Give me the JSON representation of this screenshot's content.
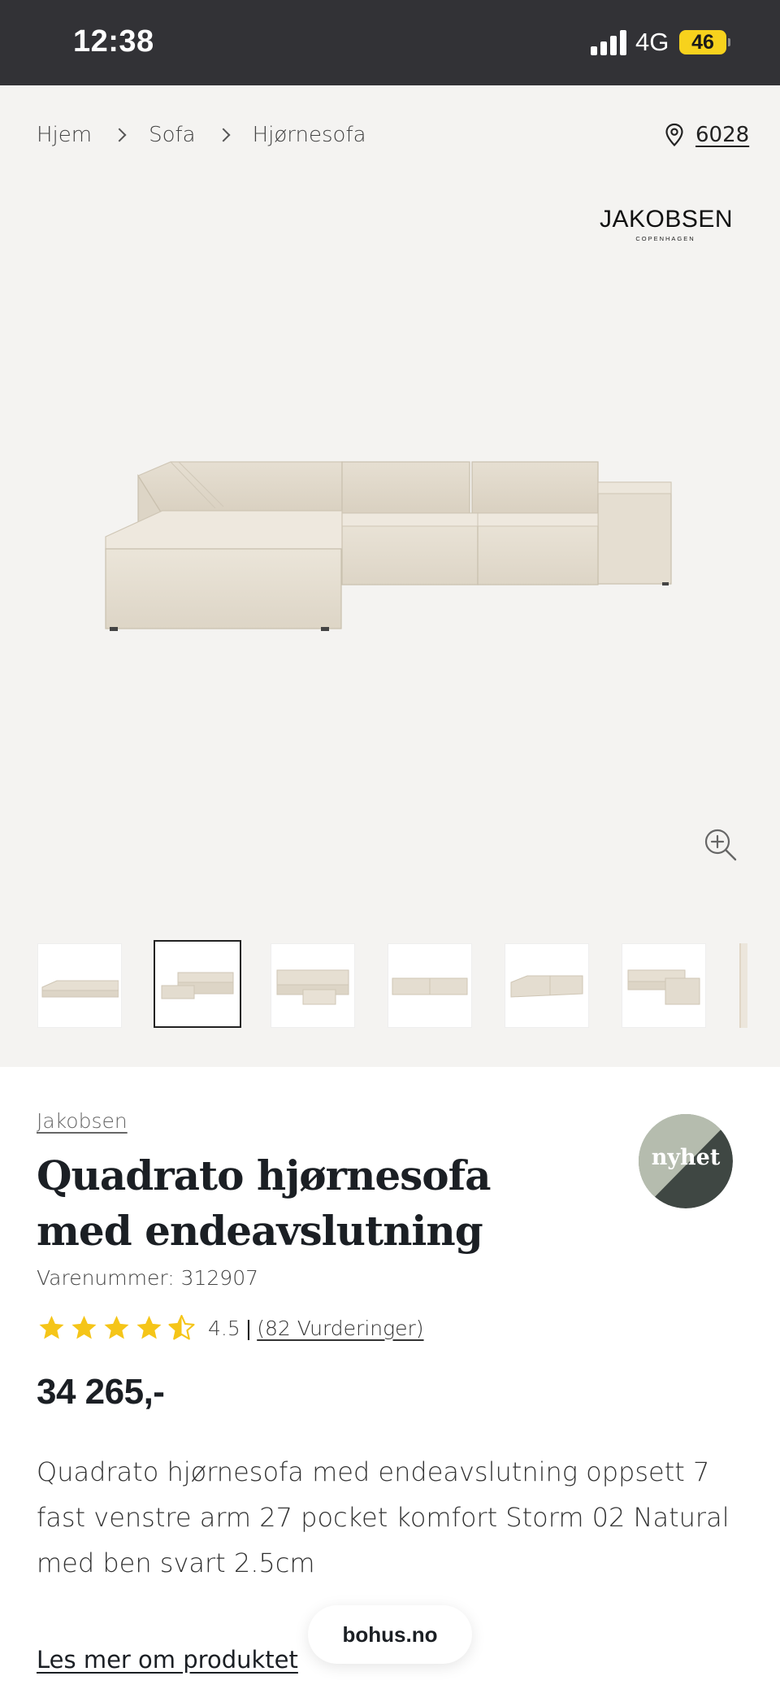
{
  "status_bar": {
    "time": "12:38",
    "network": "4G",
    "battery": "46"
  },
  "breadcrumb": {
    "items": [
      {
        "label": "Hjem"
      },
      {
        "label": "Sofa"
      },
      {
        "label": "Hjørnesofa"
      }
    ]
  },
  "store": {
    "icon": "location-pin-icon",
    "label": "6028"
  },
  "brand_logo": {
    "name": "JAKOBSEN",
    "tagline": "COPENHAGEN"
  },
  "gallery": {
    "thumbnail_count": 6,
    "active_thumbnail": 2,
    "zoom_icon": "zoom-in-icon"
  },
  "product": {
    "brand": "Jakobsen",
    "title": "Quadrato hjørnesofa med endeavslutning",
    "sku": "Varenummer: 312907",
    "rating_value": "4.5",
    "rating_divider": "|",
    "rating_count": "(82 Vurderinger)",
    "rating_stars": 4.5,
    "price": "34 265,-",
    "description": "Quadrato hjørnesofa med endeavslutning oppsett 7 fast venstre arm 27 pocket komfort Storm 02 Natural med ben svart 2.5cm",
    "read_more": "Les mer om produktet",
    "badge": "nyhet"
  },
  "site_pill": "bohus.no",
  "colors": {
    "star": "#f5c518",
    "badge_light": "#b5bcae",
    "badge_dark": "#3f4743",
    "gallery_bg": "#f4f3f1",
    "sofa": "#e4ddd0"
  }
}
